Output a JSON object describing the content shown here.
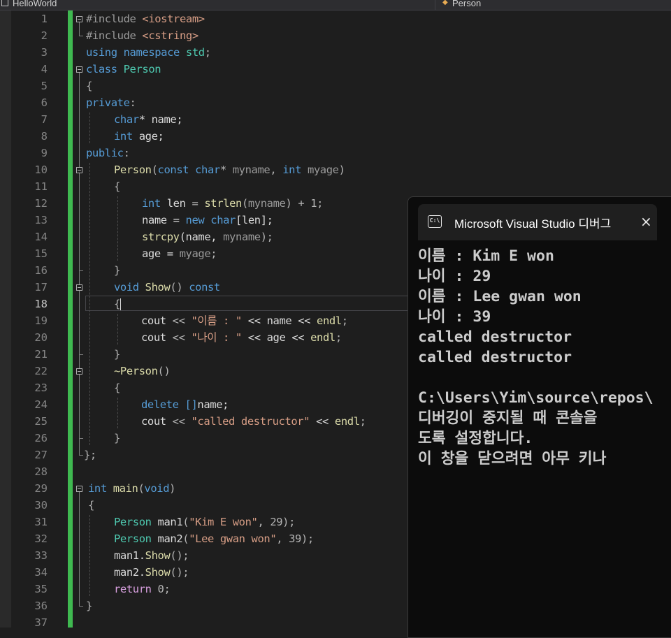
{
  "top_bar": {
    "file_tab": "HelloWorld",
    "class_dropdown": "Person"
  },
  "editor": {
    "current_line": 18,
    "lines": [
      {
        "no": "1",
        "tokens": [
          {
            "t": "#include ",
            "c": "pp"
          },
          {
            "t": "<iostream>",
            "c": "s"
          }
        ]
      },
      {
        "no": "2",
        "tokens": [
          {
            "t": "#include ",
            "c": "pp"
          },
          {
            "t": "<cstring>",
            "c": "s"
          }
        ]
      },
      {
        "no": "3",
        "tokens": [
          {
            "t": "using ",
            "c": "k"
          },
          {
            "t": "namespace ",
            "c": "k"
          },
          {
            "t": "std",
            "c": "t"
          },
          {
            "t": ";",
            "c": "pu"
          }
        ]
      },
      {
        "no": "4",
        "tokens": [
          {
            "t": "class ",
            "c": "k"
          },
          {
            "t": "Person",
            "c": "t"
          }
        ]
      },
      {
        "no": "5",
        "tokens": [
          {
            "t": "{",
            "c": "pu"
          }
        ]
      },
      {
        "no": "6",
        "tokens": [
          {
            "t": "private",
            "c": "k"
          },
          {
            "t": ":",
            "c": "pu"
          }
        ]
      },
      {
        "no": "7",
        "tokens": [
          {
            "t": "char",
            "c": "k"
          },
          {
            "t": "* name;",
            "c": ""
          }
        ]
      },
      {
        "no": "8",
        "tokens": [
          {
            "t": "int ",
            "c": "k"
          },
          {
            "t": "age;",
            "c": ""
          }
        ]
      },
      {
        "no": "9",
        "tokens": [
          {
            "t": "public",
            "c": "k"
          },
          {
            "t": ":",
            "c": "pu"
          }
        ]
      },
      {
        "no": "10",
        "tokens": [
          {
            "t": "Person",
            "c": "f"
          },
          {
            "t": "(",
            "c": "pu"
          },
          {
            "t": "const ",
            "c": "k"
          },
          {
            "t": "char",
            "c": "k"
          },
          {
            "t": "* ",
            "c": "pu"
          },
          {
            "t": "myname",
            "c": "p"
          },
          {
            "t": ", ",
            "c": "pu"
          },
          {
            "t": "int ",
            "c": "k"
          },
          {
            "t": "myage",
            "c": "p"
          },
          {
            "t": ")",
            "c": "pu"
          }
        ]
      },
      {
        "no": "11",
        "tokens": [
          {
            "t": "{",
            "c": "pu"
          }
        ]
      },
      {
        "no": "12",
        "tokens": [
          {
            "t": "int ",
            "c": "k"
          },
          {
            "t": "len ",
            "c": ""
          },
          {
            "t": "= ",
            "c": "pu"
          },
          {
            "t": "strlen",
            "c": "f"
          },
          {
            "t": "(",
            "c": "pu"
          },
          {
            "t": "myname",
            "c": "p"
          },
          {
            "t": ") + 1;",
            "c": "pu"
          }
        ]
      },
      {
        "no": "13",
        "tokens": [
          {
            "t": "name = ",
            "c": ""
          },
          {
            "t": "new ",
            "c": "k"
          },
          {
            "t": "char",
            "c": "k"
          },
          {
            "t": "[len];",
            "c": ""
          }
        ]
      },
      {
        "no": "14",
        "tokens": [
          {
            "t": "strcpy",
            "c": "f"
          },
          {
            "t": "(name, ",
            "c": ""
          },
          {
            "t": "myname",
            "c": "p"
          },
          {
            "t": ");",
            "c": "pu"
          }
        ]
      },
      {
        "no": "15",
        "tokens": [
          {
            "t": "age = ",
            "c": ""
          },
          {
            "t": "myage",
            "c": "p"
          },
          {
            "t": ";",
            "c": "pu"
          }
        ]
      },
      {
        "no": "16",
        "tokens": [
          {
            "t": "}",
            "c": "pu"
          }
        ]
      },
      {
        "no": "17",
        "tokens": [
          {
            "t": "void ",
            "c": "k"
          },
          {
            "t": "Show",
            "c": "f"
          },
          {
            "t": "() ",
            "c": "pu"
          },
          {
            "t": "const",
            "c": "k"
          }
        ]
      },
      {
        "no": "18",
        "tokens": [
          {
            "t": "{",
            "c": "pu"
          }
        ]
      },
      {
        "no": "19",
        "tokens": [
          {
            "t": "cout ",
            "c": ""
          },
          {
            "t": "<< ",
            "c": "pu"
          },
          {
            "t": "\"이름 : \"",
            "c": "s"
          },
          {
            "t": " << name << ",
            "c": ""
          },
          {
            "t": "endl",
            "c": "f"
          },
          {
            "t": ";",
            "c": "pu"
          }
        ]
      },
      {
        "no": "20",
        "tokens": [
          {
            "t": "cout ",
            "c": ""
          },
          {
            "t": "<< ",
            "c": "pu"
          },
          {
            "t": "\"나이 : \"",
            "c": "s"
          },
          {
            "t": " << age << ",
            "c": ""
          },
          {
            "t": "endl",
            "c": "f"
          },
          {
            "t": ";",
            "c": "pu"
          }
        ]
      },
      {
        "no": "21",
        "tokens": [
          {
            "t": "}",
            "c": "pu"
          }
        ]
      },
      {
        "no": "22",
        "tokens": [
          {
            "t": "~Person",
            "c": "f"
          },
          {
            "t": "()",
            "c": "pu"
          }
        ]
      },
      {
        "no": "23",
        "tokens": [
          {
            "t": "{",
            "c": "pu"
          }
        ]
      },
      {
        "no": "24",
        "tokens": [
          {
            "t": "delete ",
            "c": "k"
          },
          {
            "t": "[]",
            "c": "k"
          },
          {
            "t": "name;",
            "c": ""
          }
        ]
      },
      {
        "no": "25",
        "tokens": [
          {
            "t": "cout ",
            "c": ""
          },
          {
            "t": "<< ",
            "c": "pu"
          },
          {
            "t": "\"called destructor\"",
            "c": "s"
          },
          {
            "t": " << ",
            "c": ""
          },
          {
            "t": "endl",
            "c": "f"
          },
          {
            "t": ";",
            "c": "pu"
          }
        ]
      },
      {
        "no": "26",
        "tokens": [
          {
            "t": "}",
            "c": "pu"
          }
        ]
      },
      {
        "no": "27",
        "tokens": [
          {
            "t": "};",
            "c": "pu"
          }
        ]
      },
      {
        "no": "28",
        "tokens": []
      },
      {
        "no": "29",
        "tokens": [
          {
            "t": "int ",
            "c": "k"
          },
          {
            "t": "main",
            "c": "f"
          },
          {
            "t": "(",
            "c": "pu"
          },
          {
            "t": "void",
            "c": "k"
          },
          {
            "t": ")",
            "c": "pu"
          }
        ]
      },
      {
        "no": "30",
        "tokens": [
          {
            "t": "{",
            "c": "pu"
          }
        ]
      },
      {
        "no": "31",
        "tokens": [
          {
            "t": "Person ",
            "c": "t"
          },
          {
            "t": "man1",
            "c": ""
          },
          {
            "t": "(",
            "c": "pu"
          },
          {
            "t": "\"Kim E won\"",
            "c": "s"
          },
          {
            "t": ", 29);",
            "c": "pu"
          }
        ]
      },
      {
        "no": "32",
        "tokens": [
          {
            "t": "Person ",
            "c": "t"
          },
          {
            "t": "man2",
            "c": ""
          },
          {
            "t": "(",
            "c": "pu"
          },
          {
            "t": "\"Lee gwan won\"",
            "c": "s"
          },
          {
            "t": ", 39);",
            "c": "pu"
          }
        ]
      },
      {
        "no": "33",
        "tokens": [
          {
            "t": "man1.",
            "c": ""
          },
          {
            "t": "Show",
            "c": "f"
          },
          {
            "t": "();",
            "c": "pu"
          }
        ]
      },
      {
        "no": "34",
        "tokens": [
          {
            "t": "man2.",
            "c": ""
          },
          {
            "t": "Show",
            "c": "f"
          },
          {
            "t": "();",
            "c": "pu"
          }
        ]
      },
      {
        "no": "35",
        "tokens": [
          {
            "t": "return ",
            "c": "ctl"
          },
          {
            "t": "0;",
            "c": "pu"
          }
        ]
      },
      {
        "no": "36",
        "tokens": [
          {
            "t": "}",
            "c": "pu"
          }
        ]
      },
      {
        "no": "37",
        "tokens": []
      }
    ]
  },
  "console": {
    "icon_label": "C:\\",
    "title": "Microsoft Visual Studio 디버그",
    "close_icon": "×",
    "lines": [
      "이름 : Kim E won",
      "나이 : 29",
      "이름 : Lee gwan won",
      "나이 : 39",
      "called destructor",
      "called destructor",
      "",
      "C:\\Users\\Yim\\source\\repos\\",
      "디버깅이 중지될 때 콘솔을",
      "도록 설정합니다.",
      "이 창을 닫으려면 아무 키나"
    ]
  }
}
